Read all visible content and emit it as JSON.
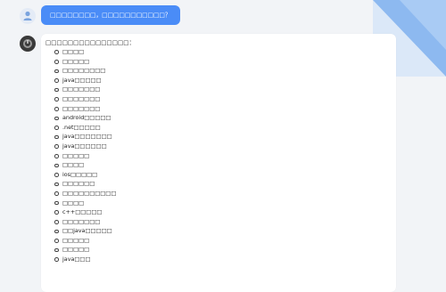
{
  "colors": {
    "background": "#f2f4f7",
    "user_bubble": "#4a8cf7",
    "corner_accent": "#8db9f0",
    "card": "#ffffff"
  },
  "user_message": {
    "text": "□□□□□□□□，□□□□□□□□□□□？",
    "avatar_icon": "user-icon"
  },
  "assistant_message": {
    "avatar_icon": "bot-icon",
    "intro": "□□□□□□□□□□□□□□□：",
    "items": [
      "□□□□",
      "□□□□□",
      "□□□□□□□□",
      "java□□□□□",
      "□□□□□□□",
      "□□□□□□□",
      "□□□□□□□",
      "android□□□□□",
      ".net□□□□□",
      "java□□□□□□□",
      "java□□□□□□",
      "□□□□□",
      "□□□□",
      "ios□□□□□",
      "□□□□□□",
      "□□□□□□□□□□",
      "□□□□",
      "c++□□□□□",
      "□□□□□□□",
      "□□java□□□□□",
      "□□□□□",
      "□□□□□",
      "java□□□"
    ]
  }
}
